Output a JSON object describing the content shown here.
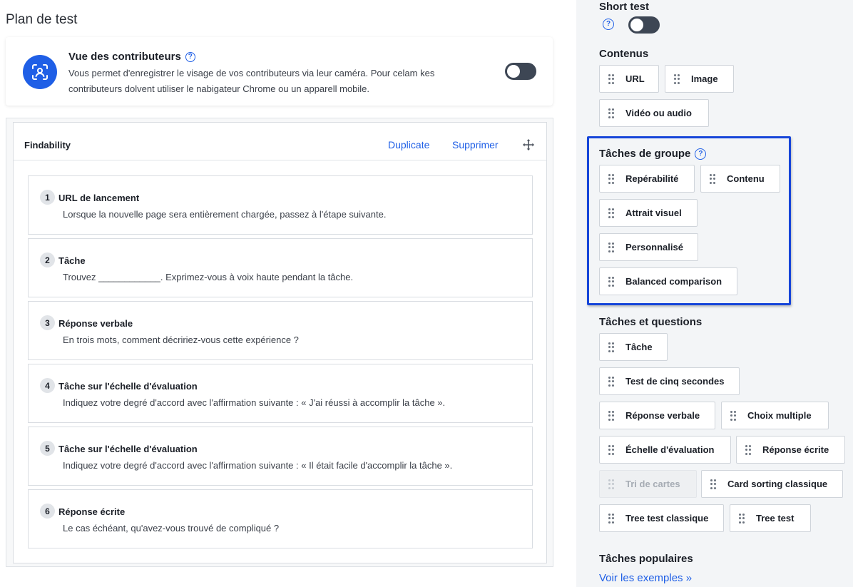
{
  "left": {
    "page_title": "Plan de test",
    "contributors": {
      "title": "Vue des contributeurs",
      "help": "?",
      "description": "Vous permet d'enregistrer le visage de vos contributeurs via leur caméra. Pour celam kes contributeurs dolvent utiliser le nabigateur Chrome ou un apparell mobile.",
      "enabled": false
    },
    "block": {
      "name": "Findability",
      "duplicate_label": "Duplicate",
      "delete_label": "Supprimer",
      "tasks": [
        {
          "num": "1",
          "title": "URL de lancement",
          "desc": "Lorsque la nouvelle page sera entièrement chargée, passez à l'étape suivante."
        },
        {
          "num": "2",
          "title": "Tâche",
          "desc": "Trouvez ____________. Exprimez-vous à voix haute pendant la tâche."
        },
        {
          "num": "3",
          "title": "Réponse verbale",
          "desc": "En trois mots, comment décririez-vous cette expérience ?"
        },
        {
          "num": "4",
          "title": "Tâche sur l'échelle d'évaluation",
          "desc": "Indiquez votre degré d'accord avec l'affirmation suivante : « J'ai réussi à accomplir la tâche »."
        },
        {
          "num": "5",
          "title": "Tâche sur l'échelle d'évaluation",
          "desc": "Indiquez votre degré d'accord avec l'affirmation suivante : « Il était facile d'accomplir la tâche »."
        },
        {
          "num": "6",
          "title": "Réponse écrite",
          "desc": "Le cas échéant, qu'avez-vous trouvé de compliqué ?"
        }
      ]
    }
  },
  "right": {
    "short_test": {
      "title": "Short test",
      "help": "?",
      "enabled": false
    },
    "contenus": {
      "title": "Contenus",
      "items": [
        "URL",
        "Image",
        "Vidéo ou audio"
      ]
    },
    "group_tasks": {
      "title": "Tâches de groupe",
      "help": "?",
      "items": [
        "Repérabilité",
        "Contenu",
        "Attrait visuel",
        "Personnalisé",
        "Balanced comparison"
      ]
    },
    "tasks_questions": {
      "title": "Tâches et questions",
      "items": [
        "Tâche",
        "Test de cinq secondes",
        "Réponse verbale",
        "Choix multiple",
        "Échelle d'évaluation",
        "Réponse écrite",
        "Tri de cartes",
        "Card sorting classique",
        "Tree test classique",
        "Tree test"
      ]
    },
    "popular": {
      "title": "Tâches populaires",
      "link": "Voir les exemples »"
    }
  },
  "colors": {
    "accent": "#1f5fe6",
    "highlight_border": "#1645d9",
    "toggle_off": "#3d4654"
  }
}
